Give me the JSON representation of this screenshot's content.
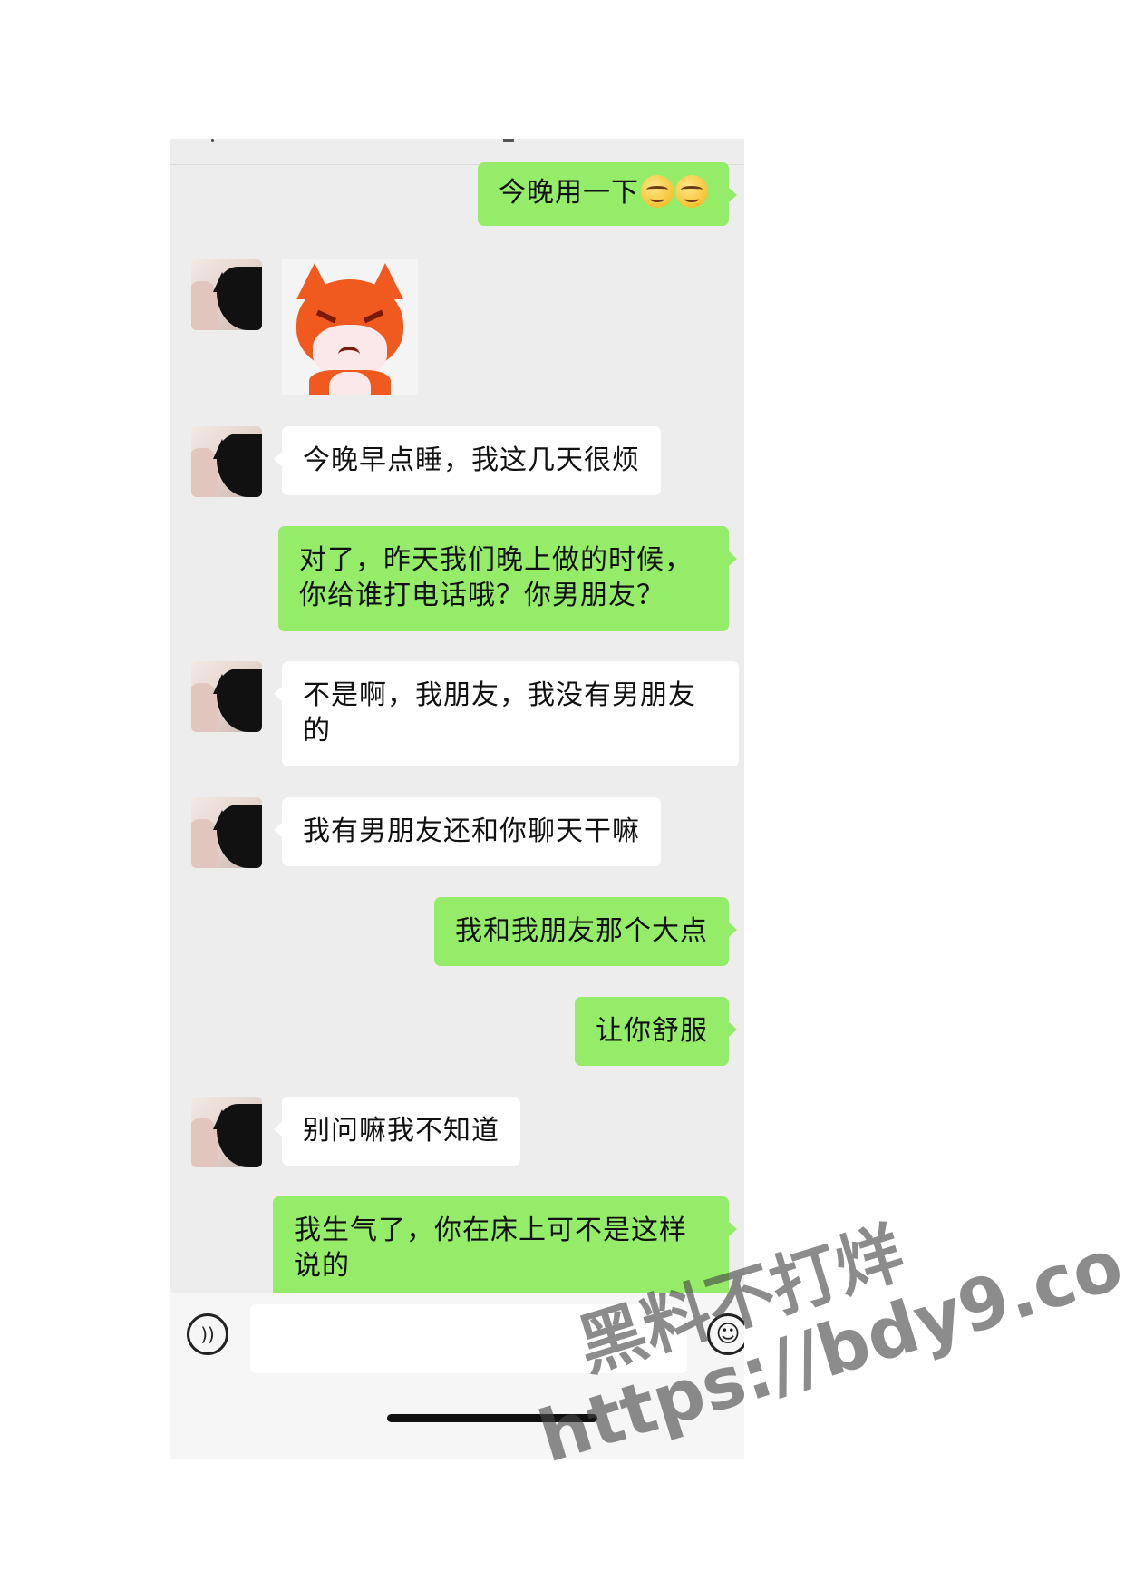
{
  "chat": {
    "messages": [
      {
        "side": "out",
        "text": "今晚用一下",
        "emojis": 2
      },
      {
        "side": "in",
        "type": "sticker",
        "sticker": "angry-fox"
      },
      {
        "side": "in",
        "text": "今晚早点睡，我这几天很烦"
      },
      {
        "side": "out",
        "text": "对了，昨天我们晚上做的时候，你给谁打电话哦？你男朋友？"
      },
      {
        "side": "in",
        "text": "不是啊，我朋友，我没有男朋友的"
      },
      {
        "side": "in",
        "text": "我有男朋友还和你聊天干嘛"
      },
      {
        "side": "out",
        "text": "我和我朋友那个大点"
      },
      {
        "side": "out",
        "text": "让你舒服"
      },
      {
        "side": "in",
        "text": "别问嘛我不知道"
      },
      {
        "side": "out",
        "text": "我生气了，你在床上可不是这样说的"
      }
    ]
  },
  "input_bar": {
    "voice_icon": "voice-wave-icon",
    "emoji_icon": "emoji-face-icon",
    "input_value": ""
  },
  "watermark": {
    "line1": "黑料不打烊",
    "line2": "https://bdy9.co"
  },
  "colors": {
    "out_bubble": "#95ec69",
    "in_bubble": "#ffffff",
    "chat_bg": "#ededed"
  }
}
